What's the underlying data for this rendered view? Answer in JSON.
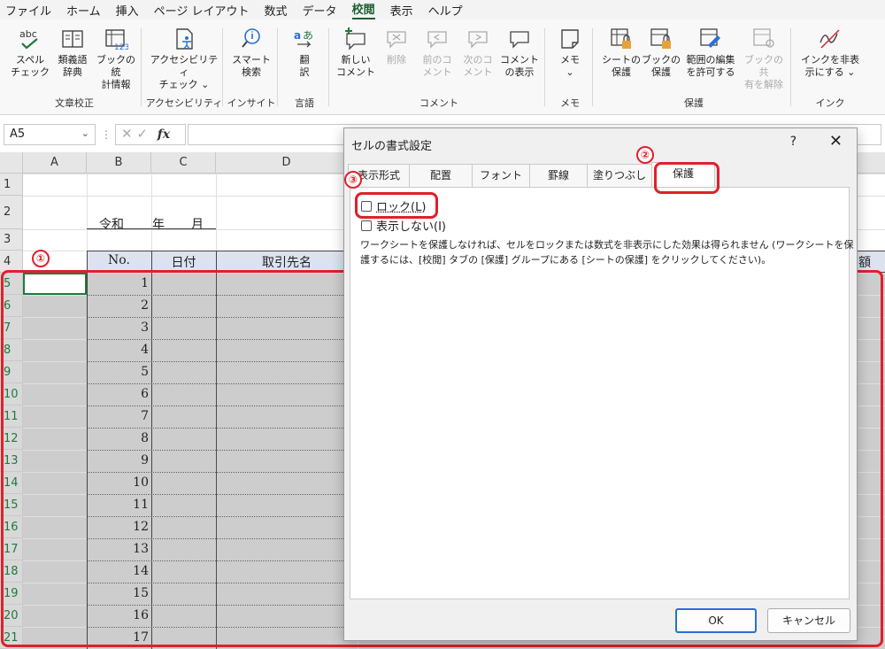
{
  "menu": [
    "ファイル",
    "ホーム",
    "挿入",
    "ページ レイアウト",
    "数式",
    "データ",
    "校閲",
    "表示",
    "ヘルプ"
  ],
  "menu_active_index": 6,
  "ribbon": {
    "groups": [
      {
        "label": "文章校正",
        "buttons": [
          {
            "label": "スペル\nチェック",
            "icon": "abc-spellcheck-icon"
          },
          {
            "label": "類義語\n辞典",
            "icon": "thesaurus-book-icon"
          },
          {
            "label": "ブックの統\n計情報",
            "icon": "workbook-stats-icon"
          }
        ]
      },
      {
        "label": "アクセシビリティ",
        "buttons": [
          {
            "label": "アクセシビリティ\nチェック ⌄",
            "icon": "accessibility-icon"
          }
        ]
      },
      {
        "label": "インサイト",
        "buttons": [
          {
            "label": "スマート\n検索",
            "icon": "smart-lookup-icon"
          }
        ]
      },
      {
        "label": "言語",
        "buttons": [
          {
            "label": "翻\n訳",
            "icon": "translate-icon"
          }
        ]
      },
      {
        "label": "コメント",
        "buttons": [
          {
            "label": "新しい\nコメント",
            "icon": "new-comment-icon"
          },
          {
            "label": "削除",
            "icon": "delete-comment-icon",
            "disabled": true
          },
          {
            "label": "前のコ\nメント",
            "icon": "previous-comment-icon",
            "disabled": true
          },
          {
            "label": "次のコ\nメント",
            "icon": "next-comment-icon",
            "disabled": true
          },
          {
            "label": "コメント\nの表示",
            "icon": "show-comments-icon"
          }
        ]
      },
      {
        "label": "メモ",
        "buttons": [
          {
            "label": "メモ\n⌄",
            "icon": "note-icon"
          }
        ]
      },
      {
        "label": "保護",
        "buttons": [
          {
            "label": "シートの\n保護",
            "icon": "protect-sheet-icon"
          },
          {
            "label": "ブックの\n保護",
            "icon": "protect-workbook-icon"
          },
          {
            "label": "範囲の編集\nを許可する",
            "icon": "allow-edit-ranges-icon"
          },
          {
            "label": "ブックの共\n有を解除",
            "icon": "unshare-workbook-icon",
            "disabled": true
          }
        ]
      },
      {
        "label": "インク",
        "buttons": [
          {
            "label": "インクを非表\n示にする ⌄",
            "icon": "hide-ink-icon"
          }
        ]
      }
    ]
  },
  "formula_bar": {
    "name_box": "A5",
    "fx": "fx",
    "value": ""
  },
  "sheet": {
    "columns": [
      "A",
      "B",
      "C",
      "D"
    ],
    "rows": [
      "1",
      "2",
      "3",
      "4",
      "5",
      "6",
      "7",
      "8",
      "9",
      "10",
      "11",
      "12",
      "13",
      "14",
      "15",
      "16",
      "17",
      "18",
      "19",
      "20",
      "21"
    ],
    "title_row": {
      "reiwa": "令和",
      "year": "年",
      "month": "月"
    },
    "headers": {
      "no": "No.",
      "date": "日付",
      "client": "取引先名",
      "amount_partial": "額"
    },
    "numbers": [
      "1",
      "2",
      "3",
      "4",
      "5",
      "6",
      "7",
      "8",
      "9",
      "10",
      "11",
      "12",
      "13",
      "14",
      "15",
      "16",
      "17"
    ]
  },
  "annotations": {
    "badge1": "①",
    "badge2": "②",
    "badge3": "③"
  },
  "dialog": {
    "title": "セルの書式設定",
    "help": "?",
    "close": "✕",
    "tabs": [
      "表示形式",
      "配置",
      "フォント",
      "罫線",
      "塗りつぶし",
      "保護"
    ],
    "active_tab": "保護",
    "lock_label": "ロック(L)",
    "lock_checked": false,
    "hidden_label": "表示しない(I)",
    "hidden_checked": false,
    "description": "ワークシートを保護しなければ、セルをロックまたは数式を非表示にした効果は得られません (ワークシートを保護するには、[校閲] タブの [保護] グループにある [シートの保護] をクリックしてください)。",
    "ok": "OK",
    "cancel": "キャンセル"
  },
  "colors": {
    "accent_green": "#1e7a3e",
    "annotation_red": "#e0202a",
    "ok_border": "#2a6fd6"
  }
}
